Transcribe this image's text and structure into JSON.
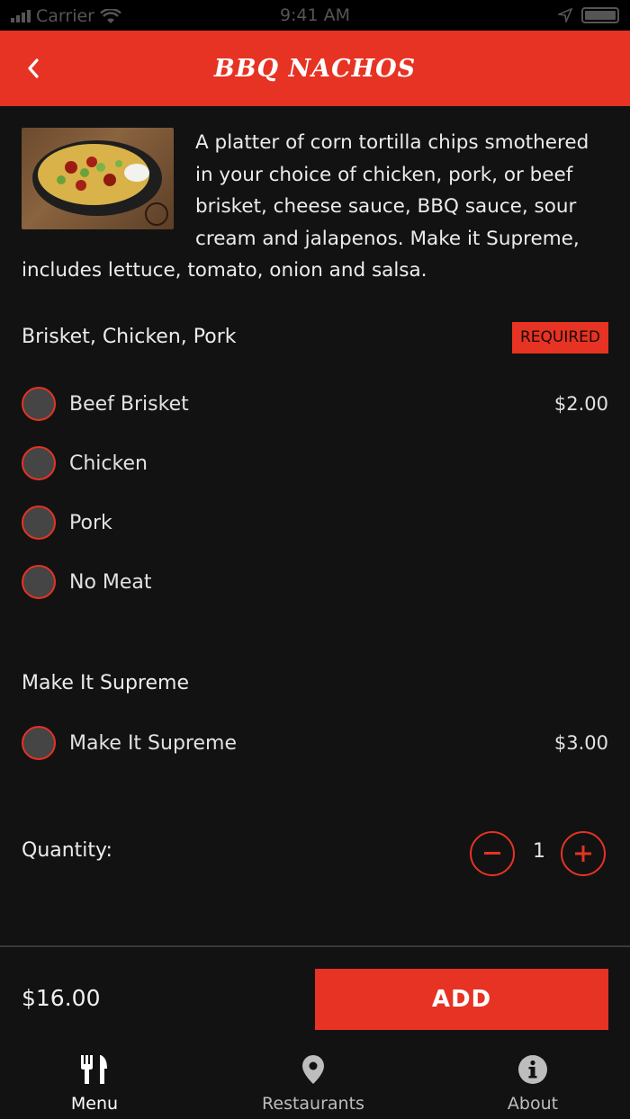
{
  "status_bar": {
    "carrier": "Carrier",
    "time": "9:41 AM"
  },
  "header": {
    "title": "BBQ NACHOS"
  },
  "item": {
    "description": "A platter of corn tortilla chips smothered in your choice of chicken, pork, or beef brisket, cheese sauce, BBQ sauce, sour cream and jalapenos. Make it Supreme, includes lettuce, tomato, onion and salsa."
  },
  "groups": [
    {
      "title": "Brisket, Chicken, Pork",
      "badge": "REQUIRED",
      "options": [
        {
          "label": "Beef Brisket",
          "price": "$2.00"
        },
        {
          "label": "Chicken",
          "price": ""
        },
        {
          "label": "Pork",
          "price": ""
        },
        {
          "label": "No Meat",
          "price": ""
        }
      ]
    },
    {
      "title": "Make It Supreme",
      "options": [
        {
          "label": "Make It Supreme",
          "price": "$3.00"
        }
      ]
    }
  ],
  "quantity": {
    "label": "Quantity:",
    "value": "1"
  },
  "footer": {
    "total": "$16.00",
    "add_label": "ADD"
  },
  "tabs": [
    {
      "label": "Menu",
      "icon": "fork-knife-icon",
      "active": true
    },
    {
      "label": "Restaurants",
      "icon": "map-pin-icon",
      "active": false
    },
    {
      "label": "About",
      "icon": "info-icon",
      "active": false
    }
  ],
  "colors": {
    "accent": "#e63323",
    "background": "#121212",
    "radio_fill": "#454545"
  }
}
